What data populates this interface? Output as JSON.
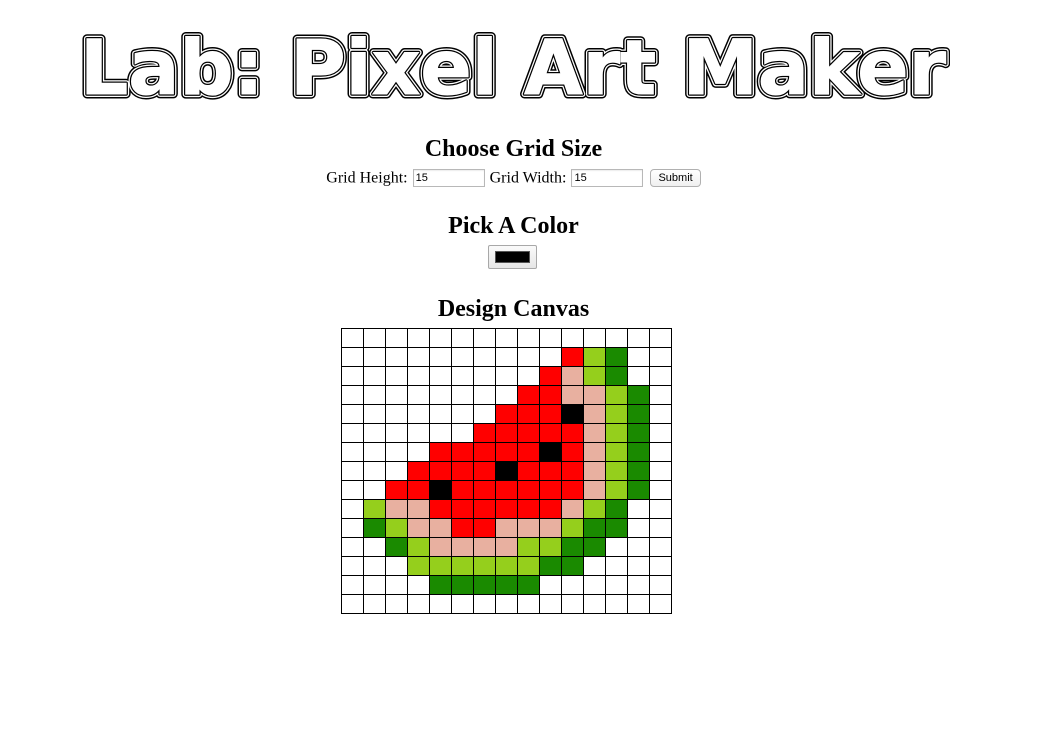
{
  "page": {
    "title": "Lab: Pixel Art Maker"
  },
  "grid_size": {
    "heading": "Choose Grid Size",
    "height_label": "Grid Height:",
    "height_value": "15",
    "width_label": "Grid Width:",
    "width_value": "15",
    "submit_label": "Submit"
  },
  "color": {
    "heading": "Pick A Color",
    "selected": "#000000"
  },
  "canvas": {
    "heading": "Design Canvas",
    "rows": 15,
    "cols": 15,
    "palette": {
      ".": "#ffffff",
      "K": "#000000",
      "R": "#ff0000",
      "P": "#e8b0a0",
      "L": "#95cf1c",
      "G": "#1a8a00"
    },
    "pixels": [
      "...............",
      "..........RLG..",
      ".........RPLG..",
      "........RRPPLG.",
      ".......RRRKPLG.",
      "......RRRRRPLG.",
      "....RRRRRKRPLG.",
      "...RRRRKRRRPLG.",
      "..RRKRRRRRRPLG.",
      ".LPPRRRRRRPLG..",
      ".GLPPRRPPPLGG..",
      "..GLPPPPLLGG...",
      "...LLLLLLGG....",
      "....GGGGG......",
      "..............."
    ]
  }
}
